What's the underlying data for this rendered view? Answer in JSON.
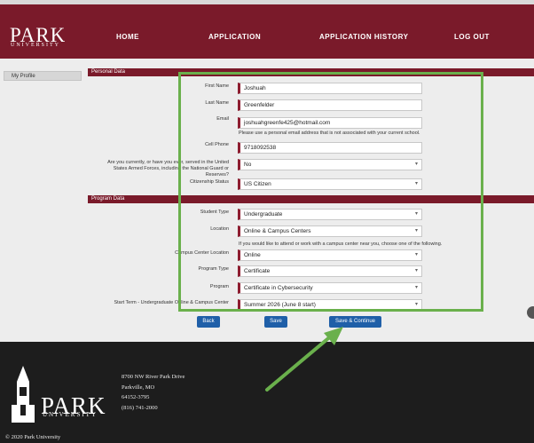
{
  "header": {
    "logo_word": "PARK",
    "logo_sub": "UNIVERSITY",
    "nav": [
      "HOME",
      "APPLICATION",
      "APPLICATION HISTORY",
      "LOG OUT"
    ]
  },
  "sidebar": {
    "my_profile": "My Profile"
  },
  "personal": {
    "section_title": "Personal Data",
    "first_name_label": "First Name",
    "first_name": "Joshuah",
    "last_name_label": "Last Name",
    "last_name": "Greenfelder",
    "email_label": "Email",
    "email": "joshuahgreenfe425@hotmail.com",
    "email_hint": "Please use a personal email address that is not associated with your current school.",
    "cell_label": "Cell Phone",
    "cell": "9718092538",
    "armed_label": "Are you currently, or have you ever, served in the United States Armed Forces, including the National Guard or Reserves?",
    "armed": "No",
    "citizen_label": "Citizenship Status",
    "citizen": "US Citizen"
  },
  "program": {
    "section_title": "Program Data",
    "student_type_label": "Student Type",
    "student_type": "Undergraduate",
    "location_label": "Location",
    "location": "Online & Campus Centers",
    "campus_hint": "If you would like to attend or work with a campus center near you, choose one of the following.",
    "campus_label": "Campus Center Location",
    "campus": "Online",
    "program_type_label": "Program Type",
    "program_type": "Certificate",
    "program_label": "Program",
    "program": "Certificate in Cybersecurity",
    "start_label": "Start Term - Undergraduate Online & Campus Center",
    "start": "Summer 2026 (June 8 start)"
  },
  "buttons": {
    "back": "Back",
    "save": "Save",
    "save_continue": "Save & Continue"
  },
  "footer": {
    "logo_word": "PARK",
    "logo_sub": "UNIVERSITY",
    "address1": "8700 NW River Park Drive",
    "address2": "Parkville, MO",
    "address3": "64152-3795",
    "phone": "(816) 741-2000",
    "copyright": "© 2020 Park University"
  },
  "colors": {
    "brand": "#7a1a2a",
    "button": "#1f5fa8",
    "highlight": "#6ab04c"
  }
}
